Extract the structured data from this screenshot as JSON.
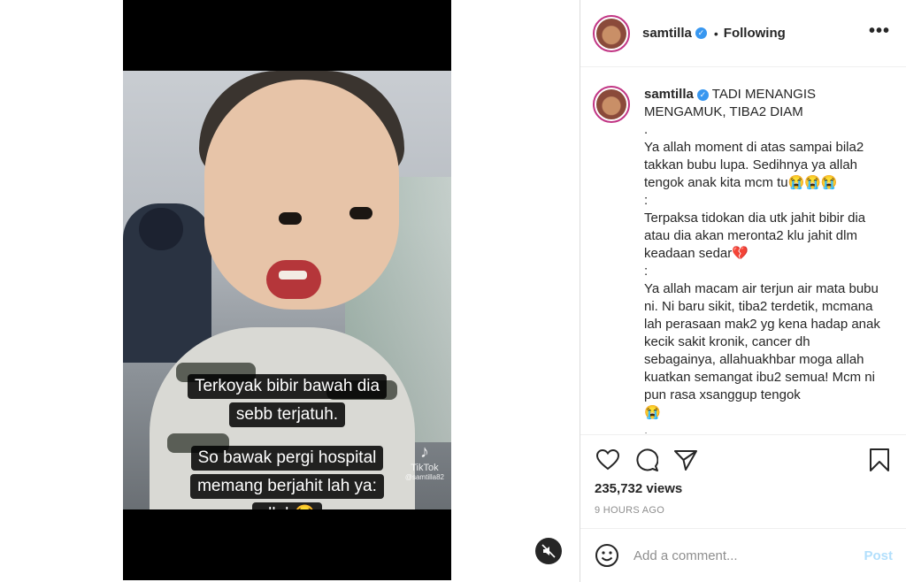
{
  "video": {
    "caption_lines_1": [
      "Terkoyak bibir bawah dia",
      "sebb terjatuh."
    ],
    "caption_lines_2": [
      "So bawak pergi hospital",
      "memang berjahit lah ya:",
      "allah😭"
    ],
    "watermark": "TikTok",
    "watermark_handle": "@samtilla82",
    "mute_icon": "muted-speaker-icon"
  },
  "header": {
    "username": "samtilla",
    "separator": "•",
    "follow_status": "Following",
    "more_icon": "•••"
  },
  "post": {
    "username": "samtilla",
    "caption": "TADI MENANGIS MENGAMUK, TIBA2 DIAM\n.\nYa allah moment di atas sampai bila2 takkan bubu lupa. Sedihnya ya allah tengok anak kita mcm tu😭😭😭\n:\nTerpaksa tidokan dia utk jahit bibir dia atau dia akan meronta2 klu jahit dlm keadaan sedar💔\n:\nYa allah macam air terjun air mata bubu ni. Ni baru sikit, tiba2 terdetik, mcmana lah perasaan mak2 yg kena hadap anak kecik sakit kronik, cancer dh sebagainya, allahuakhbar moga allah kuatkan semangat ibu2 semua! Mcm ni pun rasa xsanggup tengok\n😭\n."
  },
  "actions": {
    "icons": [
      "heart-icon",
      "comment-icon",
      "share-icon",
      "bookmark-icon"
    ],
    "views": "235,732 views",
    "timestamp": "9 HOURS AGO"
  },
  "comment_box": {
    "placeholder": "Add a comment...",
    "post_label": "Post"
  },
  "colors": {
    "verified": "#3897f0",
    "post_disabled": "#b2dffc",
    "story_ring": "#c13584"
  }
}
